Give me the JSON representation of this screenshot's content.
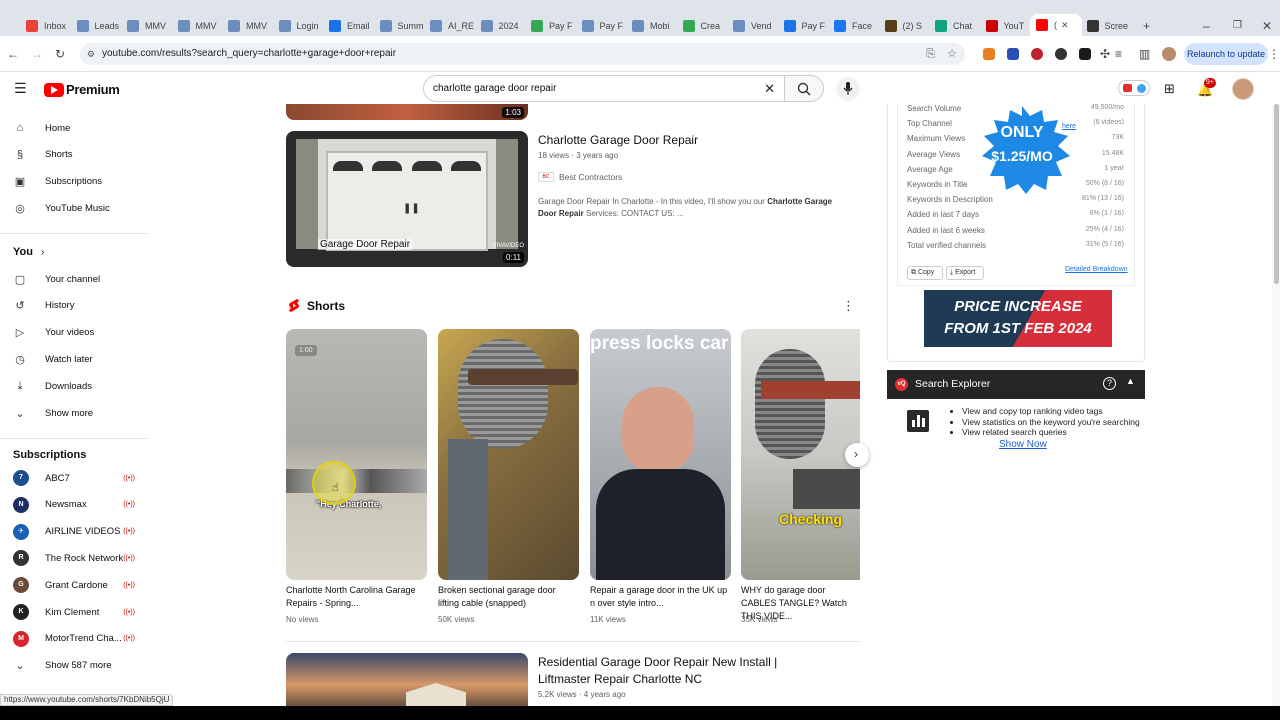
{
  "browser": {
    "tabs": [
      {
        "label": "Inbox",
        "color": "#ea4335"
      },
      {
        "label": "Leads",
        "color": "#6c8ebf"
      },
      {
        "label": "MMV",
        "color": "#6c8ebf"
      },
      {
        "label": "MMV",
        "color": "#6c8ebf"
      },
      {
        "label": "MMV",
        "color": "#6c8ebf"
      },
      {
        "label": "Login",
        "color": "#6c8ebf"
      },
      {
        "label": "Email",
        "color": "#1a73e8"
      },
      {
        "label": "Summ",
        "color": "#6c8ebf"
      },
      {
        "label": "AI_RE",
        "color": "#6c8ebf"
      },
      {
        "label": "2024",
        "color": "#6c8ebf"
      },
      {
        "label": "Pay F",
        "color": "#34a853"
      },
      {
        "label": "Pay F",
        "color": "#6c8ebf"
      },
      {
        "label": "Mobi",
        "color": "#6c8ebf"
      },
      {
        "label": "Crea",
        "color": "#34a853"
      },
      {
        "label": "Vend",
        "color": "#6c8ebf"
      },
      {
        "label": "Pay F",
        "color": "#1a73e8"
      },
      {
        "label": "Face",
        "color": "#1877f2"
      },
      {
        "label": "(2) S",
        "color": "#5a3e1b"
      },
      {
        "label": "Chat",
        "color": "#10a37f"
      },
      {
        "label": "YouT",
        "color": "#c00"
      },
      {
        "label": "(",
        "color": "#ff0000",
        "active": true
      },
      {
        "label": "Scree",
        "color": "#333"
      }
    ],
    "url": "youtube.com/results?search_query=charlotte+garage+door+repair",
    "relaunch_label": "Relaunch to update",
    "status_url": "https://www.youtube.com/shorts/7KbDNib5QjU"
  },
  "yt": {
    "logo_text": "Premium",
    "search_value": "charlotte garage door repair",
    "notif_count": "9+"
  },
  "sidebar": {
    "main": [
      {
        "label": "Home",
        "icon": "⌂"
      },
      {
        "label": "Shorts",
        "icon": "§"
      },
      {
        "label": "Subscriptions",
        "icon": "▣"
      },
      {
        "label": "YouTube Music",
        "icon": "◎"
      }
    ],
    "you_title": "You",
    "you_items": [
      {
        "label": "Your channel",
        "icon": "▢"
      },
      {
        "label": "History",
        "icon": "↺"
      },
      {
        "label": "Your videos",
        "icon": "▷"
      },
      {
        "label": "Watch later",
        "icon": "◷"
      },
      {
        "label": "Downloads",
        "icon": "⤓"
      },
      {
        "label": "Show more",
        "icon": "⌄"
      }
    ],
    "subs_title": "Subscriptions",
    "subs": [
      {
        "label": "ABC7",
        "color": "#1d4e8f",
        "abbr": "7"
      },
      {
        "label": "Newsmax",
        "color": "#1c2f63",
        "abbr": "N"
      },
      {
        "label": "AIRLINE VIDEOS",
        "color": "#1a5fb4",
        "abbr": "✈"
      },
      {
        "label": "The Rock Network",
        "color": "#333333",
        "abbr": "R"
      },
      {
        "label": "Grant Cardone",
        "color": "#6a4b3a",
        "abbr": "G"
      },
      {
        "label": "Kim Clement",
        "color": "#222222",
        "abbr": "K"
      },
      {
        "label": "MotorTrend Cha...",
        "color": "#d9232d",
        "abbr": "M"
      }
    ],
    "show_more_subs": "Show 587 more"
  },
  "results": {
    "top_duration": "1:03",
    "video1": {
      "title": "Charlotte Garage Door Repair",
      "meta": "18 views · 3 years ago",
      "channel": "Best Contractors",
      "desc_a": "Garage Door Repair In Charlotte - In this video, I'll show you our ",
      "desc_b": "Charlotte Garage Door Repair",
      "desc_c": " Services: CONTACT US: ...",
      "duration": "0:11",
      "thumb_caption": "Garage Door Repair",
      "watermark": "VIVAVIDEO"
    },
    "shorts_title": "Shorts",
    "shorts": [
      {
        "title": "Charlotte North Carolina Garage Repairs - Spring...",
        "views": "No views",
        "badge": "1:00",
        "overlay": "\"Hey Charlotte,"
      },
      {
        "title": "Broken sectional garage door lifting cable (snapped)",
        "views": "50K views",
        "overlay": ""
      },
      {
        "title": "Repair a garage door in the UK up n over style intro...",
        "views": "11K views",
        "overlay": "press locks car"
      },
      {
        "title": "WHY do garage door CABLES TANGLE? Watch THIS VIDE...",
        "views": "35K views",
        "overlay": "Checking"
      }
    ],
    "video2": {
      "title_line1": "Residential Garage Door Repair New Install |",
      "title_line2": "Liftmaster Repair Charlotte NC",
      "meta": "5.2K views · 4 years ago"
    }
  },
  "vidiq": {
    "rows": [
      {
        "label": "Search Volume",
        "value": "49,500/mo"
      },
      {
        "label": "Top Channel",
        "value": "(6 videos)"
      },
      {
        "label": "Maximum Views",
        "value": "73K"
      },
      {
        "label": "Average Views",
        "value": "15.48K"
      },
      {
        "label": "Average Age",
        "value": "1 year"
      },
      {
        "label": "Keywords in Title",
        "value": "50% (8 / 16)"
      },
      {
        "label": "Keywords in Description",
        "value": "81% (13 / 16)"
      },
      {
        "label": "Added in last 7 days",
        "value": "6% (1 / 16)"
      },
      {
        "label": "Added in last 6 weeks",
        "value": "25% (4 / 16)"
      },
      {
        "label": "Total verified channels",
        "value": "31% (5 / 16)"
      }
    ],
    "top_channel_link": "here",
    "badge_line1": "ONLY",
    "badge_price": "$1.25/MO",
    "copy_label": "Copy",
    "export_label": "Export",
    "breakdown_label": "Detailed Breakdown",
    "price_line1": "PRICE INCREASE",
    "price_line2": "FROM 1ST FEB 2024",
    "explorer_title": "Search Explorer",
    "explorer_items": [
      "View and copy top ranking video tags",
      "View statistics on the keyword you're searching",
      "View related search queries"
    ],
    "show_now": "Show Now"
  }
}
